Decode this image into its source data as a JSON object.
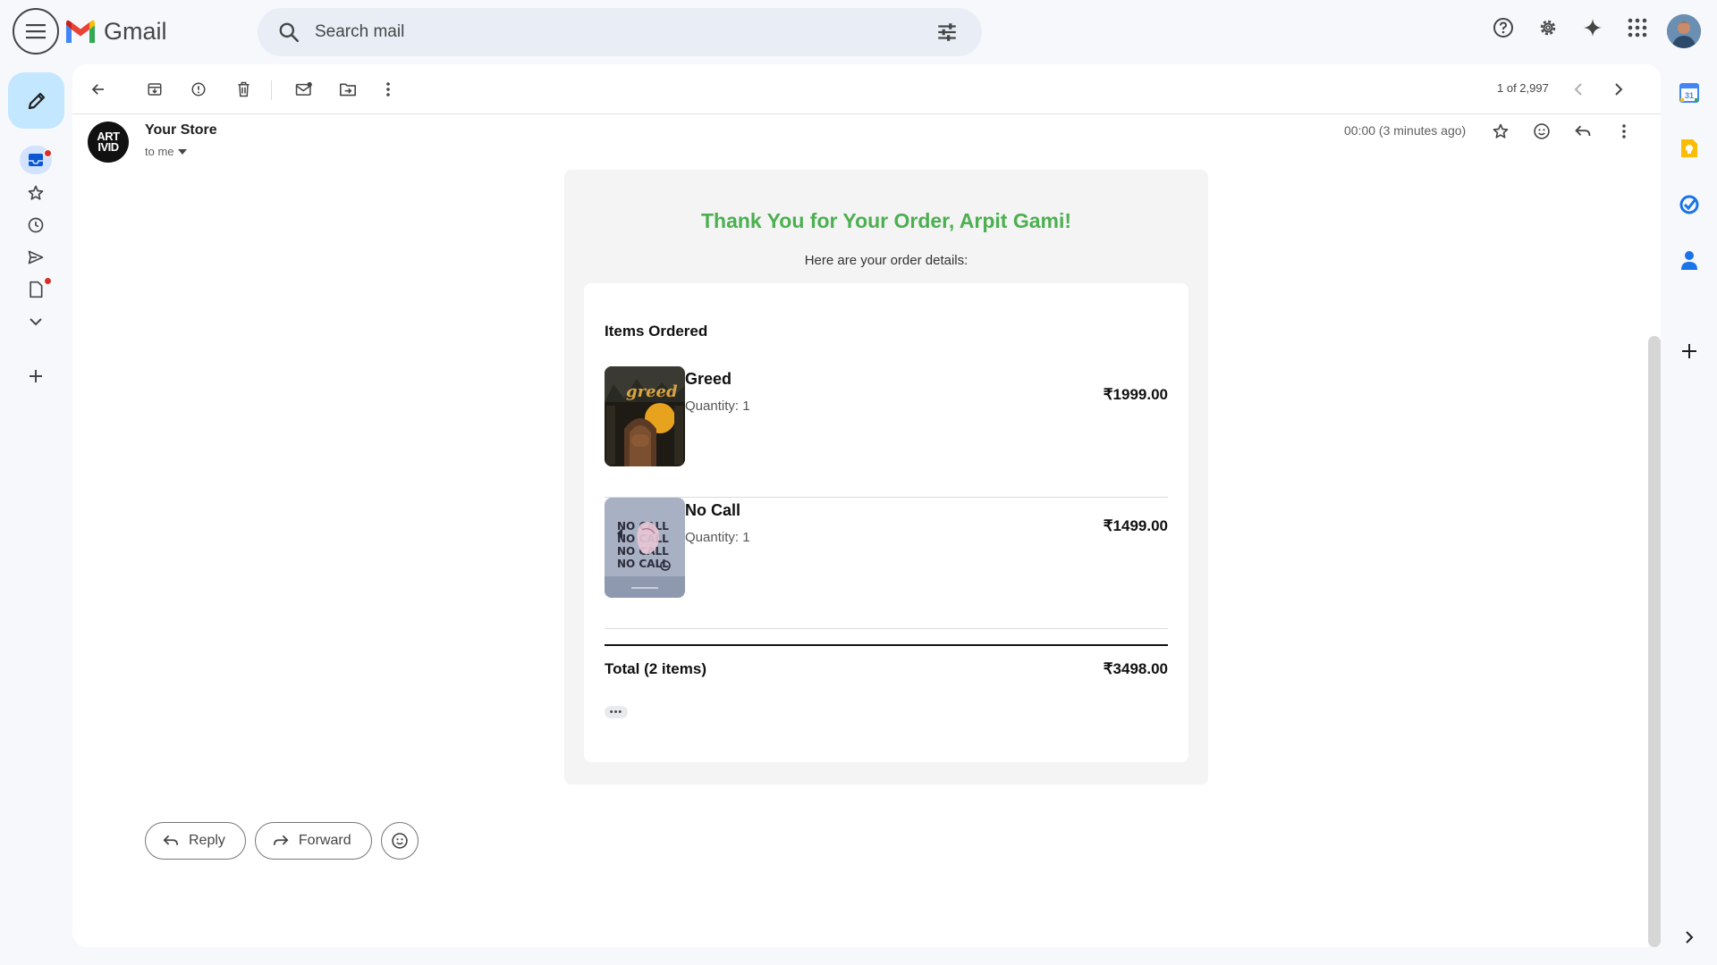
{
  "app": {
    "name": "Gmail",
    "brand_colors": {
      "red": "#EA4335",
      "blue": "#4285F4",
      "green": "#34A853",
      "yellow": "#FBBC04"
    }
  },
  "header": {
    "search_placeholder": "Search mail",
    "icons": [
      "main-menu-icon",
      "search-icon",
      "search-options-icon",
      "help-icon",
      "settings-icon",
      "gemini-icon",
      "apps-icon",
      "account-avatar"
    ]
  },
  "left_rail": {
    "items": [
      "compose-icon",
      "inbox-icon",
      "starred-icon",
      "snoozed-icon",
      "sent-icon",
      "drafts-icon",
      "more-icon",
      "add-label-icon"
    ]
  },
  "toolbar": {
    "pager_text": "1 of 2,997",
    "icons": [
      "back-icon",
      "archive-icon",
      "report-spam-icon",
      "delete-icon",
      "mark-unread-icon",
      "move-to-icon",
      "more-vert-icon",
      "newer-icon",
      "older-icon"
    ]
  },
  "message": {
    "sender_name": "Your Store",
    "sender_avatar_line1": "ART",
    "sender_avatar_line2": "IVID",
    "to_label": "to me",
    "timestamp": "00:00 (3 minutes ago)"
  },
  "email": {
    "title": "Thank You for Your Order, Arpit Gami!",
    "subtitle": "Here are your order details:",
    "accent_color": "#4caf50",
    "items_heading": "Items Ordered",
    "items": [
      {
        "name": "Greed",
        "quantity": "Quantity: 1",
        "price": "₹1999.00"
      },
      {
        "name": "No Call",
        "quantity": "Quantity: 1",
        "price": "₹1499.00"
      }
    ],
    "total_label": "Total (2 items)",
    "total_value": "₹3498.00",
    "ellipsis": "•••"
  },
  "reply_bar": {
    "reply_label": "Reply",
    "forward_label": "Forward"
  },
  "side_panel": {
    "items": [
      "calendar-icon",
      "keep-icon",
      "tasks-icon",
      "contacts-icon",
      "add-addon-icon",
      "show-side-panel-icon"
    ],
    "calendar_day": "31"
  }
}
